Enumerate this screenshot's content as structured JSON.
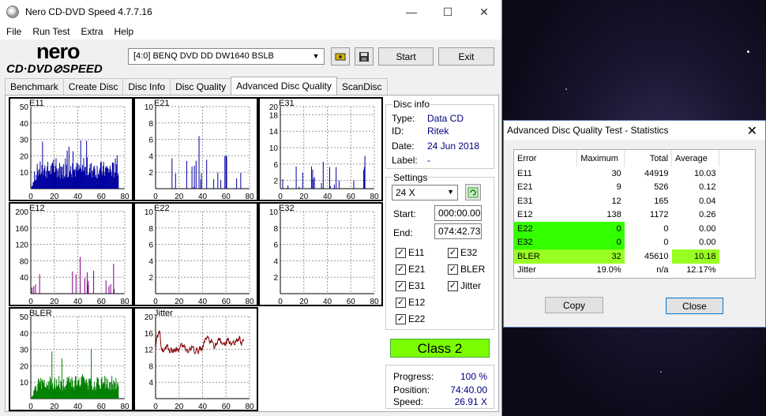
{
  "window": {
    "title": "Nero CD-DVD Speed 4.7.7.16"
  },
  "menu": [
    "File",
    "Run Test",
    "Extra",
    "Help"
  ],
  "logo": {
    "line1": "nero",
    "line2": "CD·DVD⊘SPEED"
  },
  "toolbar": {
    "drive": "[4:0]   BENQ DVD DD DW1640 BSLB",
    "start": "Start",
    "exit": "Exit"
  },
  "tabs": [
    "Benchmark",
    "Create Disc",
    "Disc Info",
    "Disc Quality",
    "Advanced Disc Quality",
    "ScanDisc"
  ],
  "active_tab": 4,
  "disc_info": {
    "label": "Disc info",
    "type_label": "Type:",
    "type": "Data CD",
    "id_label": "ID:",
    "id": "Ritek",
    "date_label": "Date:",
    "date": "24 Jun 2018",
    "disc_label_label": "Label:",
    "disc_label": "-"
  },
  "settings": {
    "label": "Settings",
    "speed": "24 X",
    "start_label": "Start:",
    "start": "000:00.00",
    "end_label": "End:",
    "end": "074:42.73",
    "checks": [
      "E11",
      "E32",
      "E21",
      "BLER",
      "E31",
      "Jitter",
      "E12",
      "E22"
    ]
  },
  "class": "Class 2",
  "progress": {
    "progress_label": "Progress:",
    "progress": "100 %",
    "position_label": "Position:",
    "position": "74:40.00",
    "speed_label": "Speed:",
    "speed": "26.91 X"
  },
  "chart_data": [
    {
      "type": "bar",
      "name": "E11",
      "yticks": [
        10,
        20,
        30,
        40,
        50
      ],
      "ylim": [
        0,
        50
      ],
      "xticks": [
        0,
        20,
        40,
        60,
        80
      ],
      "color": "#0000a0",
      "baseline": 12,
      "peak": 30
    },
    {
      "type": "bar",
      "name": "E21",
      "yticks": [
        2,
        4,
        6,
        8,
        10
      ],
      "ylim": [
        0,
        10
      ],
      "xticks": [
        0,
        20,
        40,
        60,
        80
      ],
      "color": "#0000a0",
      "baseline": 0,
      "peak": 9
    },
    {
      "type": "bar",
      "name": "E31",
      "yticks": [
        2,
        6,
        10,
        14,
        18,
        20
      ],
      "ylim": [
        0,
        20
      ],
      "xticks": [
        0,
        20,
        40,
        60,
        80
      ],
      "color": "#0000a0",
      "baseline": 0,
      "peak": 12
    },
    {
      "type": "bar",
      "name": "E12",
      "yticks": [
        40,
        80,
        120,
        160,
        200
      ],
      "ylim": [
        0,
        200
      ],
      "xticks": [
        0,
        20,
        40,
        60,
        80
      ],
      "color": "#800080",
      "baseline": 0,
      "peak": 138
    },
    {
      "type": "bar",
      "name": "E22",
      "yticks": [
        2,
        4,
        6,
        8,
        10
      ],
      "ylim": [
        0,
        10
      ],
      "xticks": [
        0,
        20,
        40,
        60,
        80
      ],
      "color": "#0000a0",
      "baseline": 0,
      "peak": 0
    },
    {
      "type": "bar",
      "name": "E32",
      "yticks": [
        2,
        4,
        6,
        8,
        10
      ],
      "ylim": [
        0,
        10
      ],
      "xticks": [
        0,
        20,
        40,
        60,
        80
      ],
      "color": "#0000a0",
      "baseline": 0,
      "peak": 0
    },
    {
      "type": "bar",
      "name": "BLER",
      "yticks": [
        10,
        20,
        30,
        40,
        50
      ],
      "ylim": [
        0,
        50
      ],
      "xticks": [
        0,
        20,
        40,
        60,
        80
      ],
      "color": "#008000",
      "baseline": 10,
      "peak": 32
    },
    {
      "type": "line",
      "name": "Jitter",
      "yticks": [
        4,
        8,
        12,
        16,
        20
      ],
      "ylim": [
        0,
        20
      ],
      "xticks": [
        0,
        20,
        40,
        60,
        80
      ],
      "color": "#800000",
      "baseline": 12,
      "peak": 15
    }
  ],
  "stats": {
    "title": "Advanced Disc Quality Test - Statistics",
    "headers": [
      "Error",
      "Maximum",
      "Total",
      "Average"
    ],
    "rows": [
      [
        "E11",
        "30",
        "44919",
        "10.03"
      ],
      [
        "E21",
        "9",
        "526",
        "0.12"
      ],
      [
        "E31",
        "12",
        "165",
        "0.04"
      ],
      [
        "E12",
        "138",
        "1172",
        "0.26"
      ],
      [
        "E22",
        "0",
        "0",
        "0.00"
      ],
      [
        "E32",
        "0",
        "0",
        "0.00"
      ],
      [
        "BLER",
        "32",
        "45610",
        "10.18"
      ],
      [
        "Jitter",
        "19.0%",
        "n/a",
        "12.17%"
      ]
    ],
    "copy": "Copy",
    "close": "Close"
  }
}
